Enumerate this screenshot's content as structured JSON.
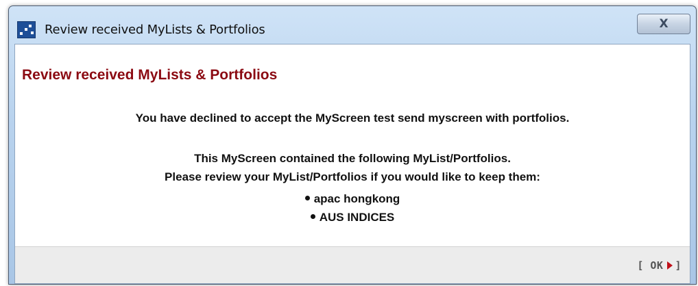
{
  "window": {
    "title": "Review received MyLists & Portfolios",
    "close_label": "X"
  },
  "dialog": {
    "heading": "Review received MyLists & Portfolios",
    "message_declined": "You have declined to accept the MyScreen test send myscreen with portfolios.",
    "message_contained": "This MyScreen contained the following MyList/Portfolios.",
    "message_review": "Please review your MyList/Portfolios if you would like to keep them:",
    "portfolios": [
      "apac hongkong",
      "AUS INDICES"
    ]
  },
  "footer": {
    "ok_open": "[",
    "ok_label": "OK",
    "ok_close": "]"
  },
  "colors": {
    "heading": "#8b0a12",
    "ok_arrow": "#c0101a",
    "footer_bg": "#ececec"
  },
  "icons": {
    "app": "app-window-icon",
    "close": "close-icon",
    "ok_arrow": "triangle-right-icon"
  }
}
